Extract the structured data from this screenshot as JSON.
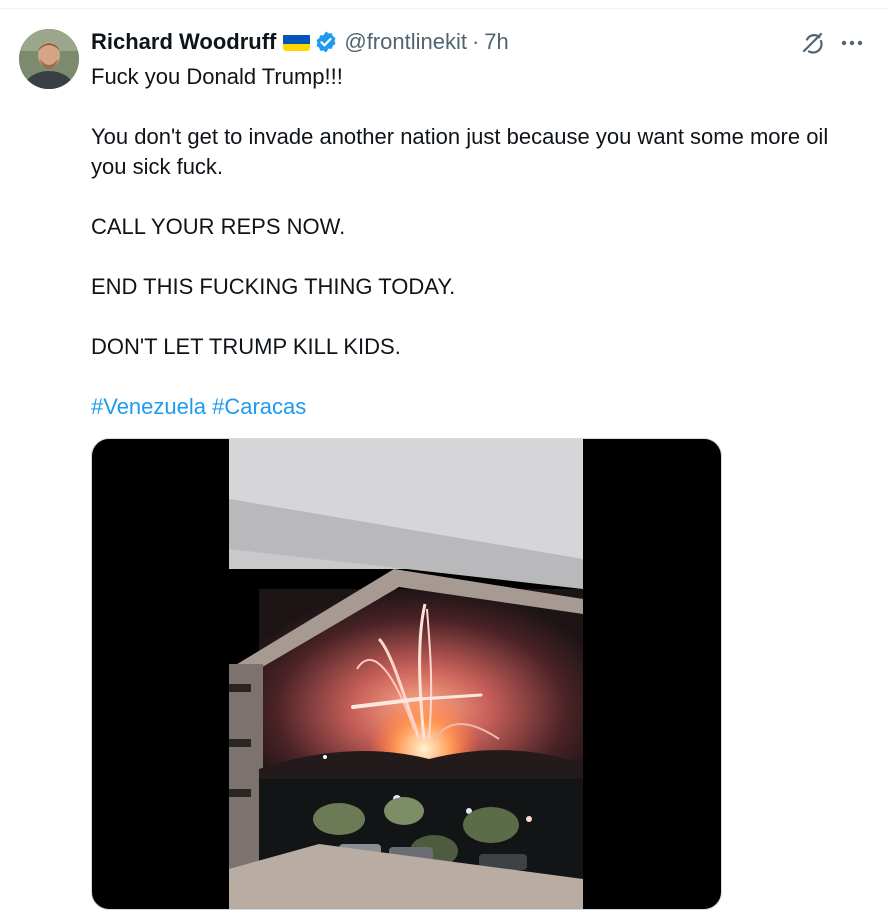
{
  "tweet": {
    "author": {
      "display_name": "Richard Woodruff",
      "handle": "@frontlinekit",
      "verified": true,
      "flag": "ukraine-flag"
    },
    "separator": "·",
    "timestamp": "7h",
    "text_paragraphs": [
      "Fuck you Donald Trump!!!",
      "You don't get to invade another nation just because you want some more oil you sick fuck.",
      "CALL YOUR REPS NOW.",
      "END THIS FUCKING THING TODAY.",
      "DON'T LET TRUMP KILL KIDS."
    ],
    "hashtags": [
      "#Venezuela",
      "#Caracas"
    ],
    "media": {
      "type": "video",
      "subject": "explosion-at-night-icon"
    }
  },
  "icons": {
    "grok": "grok-icon",
    "more": "more-icon",
    "verified": "verified-badge-icon"
  },
  "colors": {
    "link": "#1d9bf0",
    "secondary_text": "#536471",
    "primary_text": "#0f1419",
    "verified_blue": "#1d9bf0",
    "flag_blue": "#0057b7",
    "flag_yellow": "#ffd700"
  }
}
